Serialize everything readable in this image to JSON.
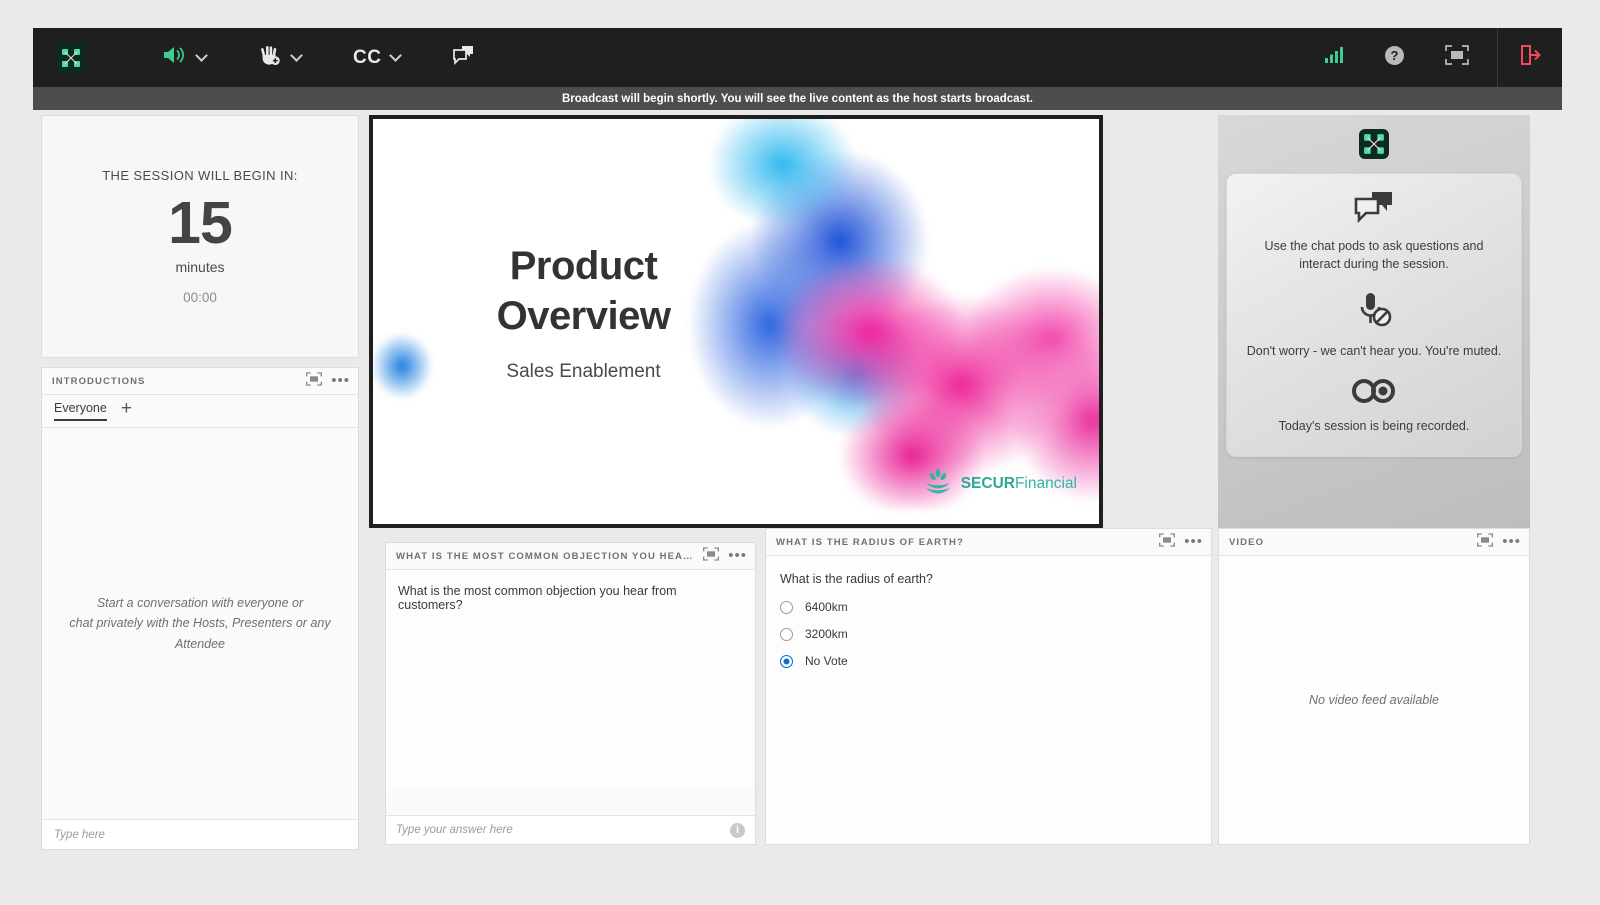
{
  "toolbar": {
    "logo_icon": "connect-logo-icon",
    "items": [
      {
        "name": "speaker",
        "icon": "speaker-icon",
        "has_chevron": true
      },
      {
        "name": "raise-hand",
        "icon": "raise-hand-icon",
        "has_chevron": true
      },
      {
        "name": "closed-captions",
        "icon": "cc-text",
        "label": "CC",
        "has_chevron": true
      },
      {
        "name": "chat",
        "icon": "chat-bubble-icon",
        "has_chevron": false
      }
    ],
    "right_items": [
      {
        "name": "network-status",
        "icon": "signal-bars-icon"
      },
      {
        "name": "help",
        "icon": "question-circle-icon"
      },
      {
        "name": "fullscreen",
        "icon": "fullscreen-icon"
      },
      {
        "name": "leave-session",
        "icon": "exit-icon"
      }
    ],
    "accent_green": "#3ecf8e",
    "accent_red": "#f2495c",
    "background": "#1f1f1f"
  },
  "notice": {
    "message": "Broadcast will begin shortly. You will see the live content as the host starts broadcast.",
    "background": "#4d4d4d"
  },
  "timer": {
    "label": "THE SESSION WILL BEGIN IN:",
    "value": "15",
    "unit": "minutes",
    "clock": "00:00"
  },
  "chat_pod": {
    "title": "INTRODUCTIONS",
    "tab": "Everyone",
    "add_tab": "+",
    "empty_line_1": "Start a conversation with everyone or",
    "empty_line_2": "chat privately with the Hosts, Presenters or any Attendee",
    "input_placeholder": "Type here"
  },
  "slide": {
    "title_line_1": "Product",
    "title_line_2": "Overview",
    "subtitle": "Sales Enablement",
    "logo_bold": "SECUR",
    "logo_light": "Financial",
    "logo_color": "#2fb7a0"
  },
  "info_panel": {
    "items": [
      {
        "icon": "chat-bubbles-icon",
        "text": "Use the chat pods to ask questions and interact during the session."
      },
      {
        "icon": "mic-muted-icon",
        "text": "Don't worry - we can't hear you. You're muted."
      },
      {
        "icon": "recording-icon",
        "text": "Today's session is being recorded."
      }
    ]
  },
  "qa_pod": {
    "title": "WHAT IS THE MOST COMMON OBJECTION YOU HEAR FROM CUS...",
    "question": "What is the most common objection you hear from customers?",
    "input_placeholder": "Type your answer here",
    "info_badge": "i"
  },
  "poll_pod": {
    "title": "WHAT IS THE RADIUS OF EARTH?",
    "question": "What is the radius of earth?",
    "options": [
      {
        "label": "6400km",
        "selected": false
      },
      {
        "label": "3200km",
        "selected": false
      },
      {
        "label": "No Vote",
        "selected": true
      }
    ],
    "selected_color": "#0a6ed1"
  },
  "video_pod": {
    "title": "VIDEO",
    "empty_text": "No video feed available"
  }
}
